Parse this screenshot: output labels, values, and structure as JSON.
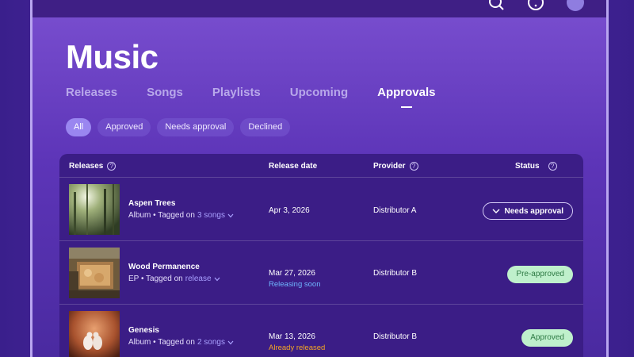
{
  "page": {
    "title": "Music"
  },
  "tabs": [
    {
      "label": "Releases",
      "active": false
    },
    {
      "label": "Songs",
      "active": false
    },
    {
      "label": "Playlists",
      "active": false
    },
    {
      "label": "Upcoming",
      "active": false
    },
    {
      "label": "Approvals",
      "active": true
    }
  ],
  "filters": [
    {
      "label": "All",
      "active": true
    },
    {
      "label": "Approved",
      "active": false
    },
    {
      "label": "Needs approval",
      "active": false
    },
    {
      "label": "Declined",
      "active": false
    }
  ],
  "table": {
    "headers": {
      "releases": "Releases",
      "release_date": "Release date",
      "provider": "Provider",
      "status": "Status"
    },
    "rows": [
      {
        "title": "Aspen Trees",
        "type_prefix": "Album • Tagged on",
        "tag_link": "3 songs",
        "date": "Apr 3, 2026",
        "note": "",
        "provider": "Distributor A",
        "status": "Needs approval"
      },
      {
        "title": "Wood Permanence",
        "type_prefix": "EP • Tagged on",
        "tag_link": "release",
        "date": "Mar 27, 2026",
        "note": "Releasing soon",
        "provider": "Distributor B",
        "status": "Pre-approved"
      },
      {
        "title": "Genesis",
        "type_prefix": "Album • Tagged on",
        "tag_link": "2 songs",
        "date": "Mar 13, 2026",
        "note": "Already released",
        "provider": "Distributor B",
        "status": "Approved"
      }
    ]
  },
  "colors": {
    "accent": "#9a86f0",
    "releasing_soon": "#6fb6ff",
    "already_released": "#f5a623",
    "approved_bg": "#bff0cc",
    "approved_text": "#2e7a44"
  },
  "icons": {
    "top": [
      "search-icon",
      "help-icon",
      "avatar"
    ],
    "header_help": "help-icon",
    "tag_dropdown": "chevron-down-icon"
  }
}
